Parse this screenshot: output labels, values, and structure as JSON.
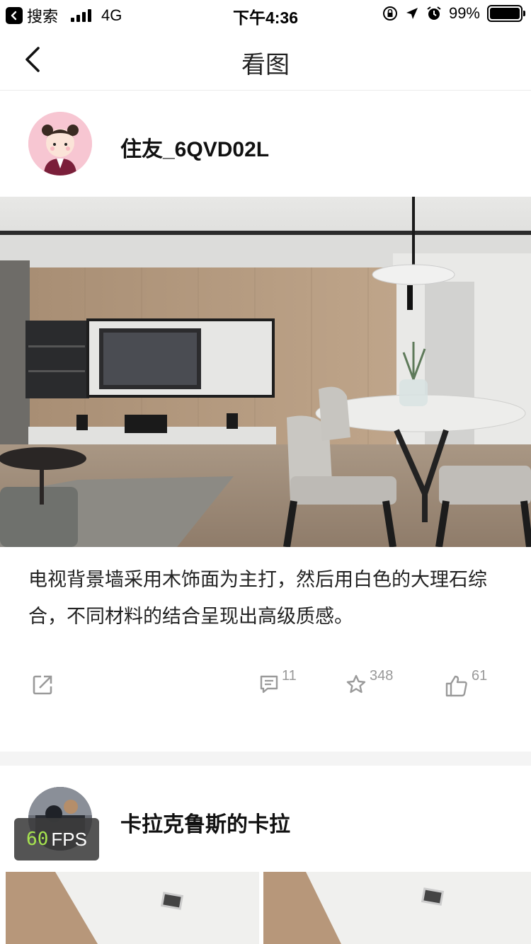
{
  "status_bar": {
    "back_app": "搜索",
    "network": "4G",
    "time": "下午4:36",
    "battery": "99%",
    "battery_level": 0.99
  },
  "nav": {
    "title": "看图"
  },
  "post": {
    "username": "住友_6QVD02L",
    "caption": "电视背景墙采用木饰面为主打，然后用白色的大理石综合，不同材料的结合呈现出高级质感。",
    "actions": {
      "comments": "11",
      "favorites": "348",
      "likes": "61"
    }
  },
  "post2": {
    "username": "卡拉克鲁斯的卡拉"
  },
  "fps": {
    "value": "60",
    "label": "FPS"
  },
  "colors": {
    "wood": "#b59a7f",
    "icon_gray": "#9a9a9a",
    "fps_green": "#a6e34f"
  }
}
